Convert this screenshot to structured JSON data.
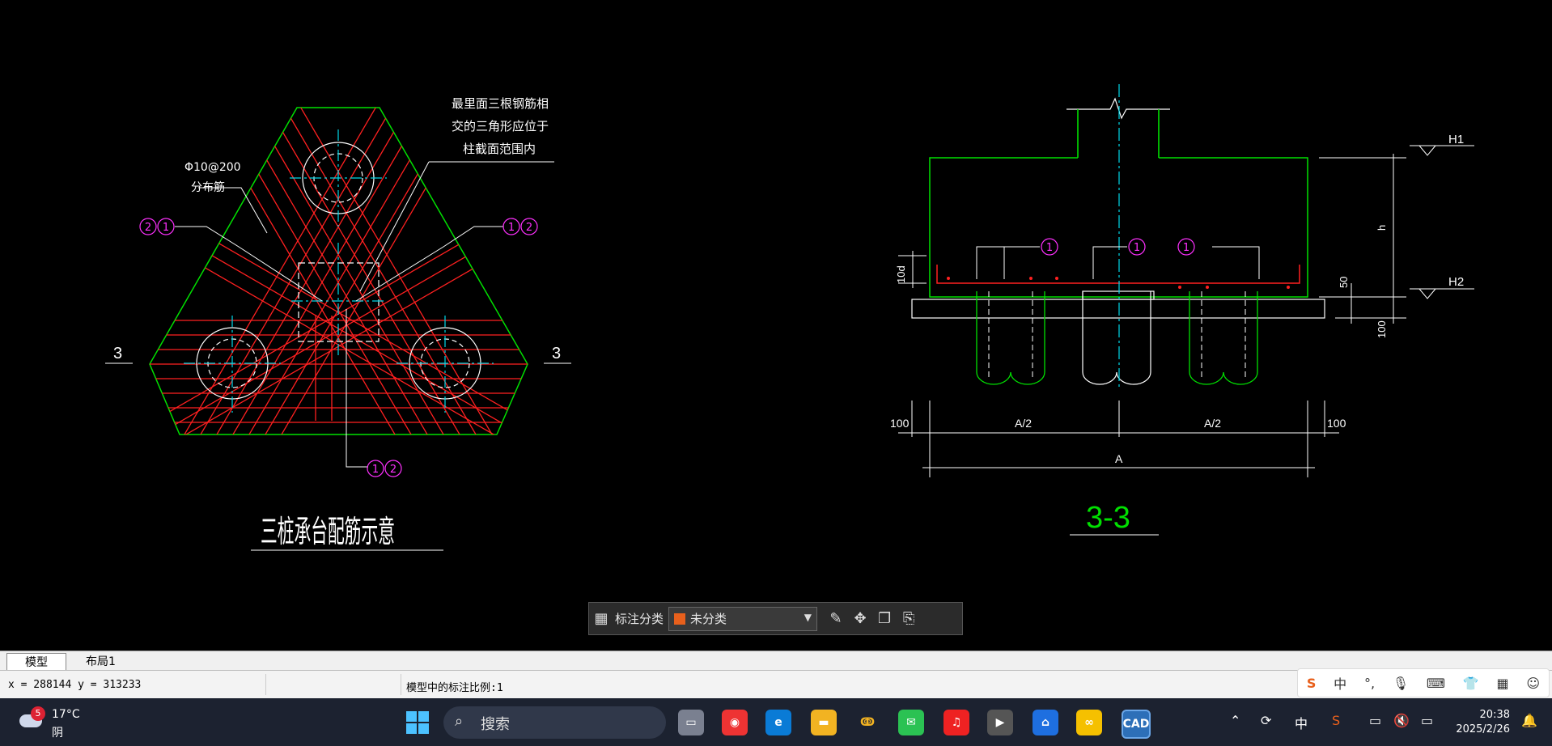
{
  "drawing": {
    "left_title": "三桩承台配筋示意",
    "right_title": "3-3",
    "note_top": [
      "最里面三根钢筋相",
      "交的三角形应位于",
      "柱截面范围内"
    ],
    "note_left": [
      "Φ10@200",
      "分布筋"
    ],
    "section_mark_left": "3",
    "section_mark_right": "3",
    "bubble_1": "1",
    "bubble_2": "2",
    "dim_100_left": "100",
    "dim_100_right": "100",
    "dim_a2_left": "A/2",
    "dim_a2_right": "A/2",
    "dim_a": "A",
    "dim_h": "h",
    "dim_10d": "10d",
    "dim_50": "50",
    "dim_100_v": "100",
    "level_h1": "H1",
    "level_h2": "H2"
  },
  "float_toolbar": {
    "label": "标注分类",
    "selected": "未分类",
    "swatch_color": "#e8601c"
  },
  "tabs": [
    "模型",
    "布局1"
  ],
  "status": {
    "coords": "x = 288144  y = 313233",
    "scale": "模型中的标注比例:1"
  },
  "ime": {
    "lang": "中",
    "punct": "°,"
  },
  "taskbar": {
    "weather_badge": "5",
    "temp": "17°C",
    "cond": "阴",
    "search_placeholder": "搜索",
    "tray_lang": "中",
    "time": "20:38",
    "date": "2025/2/26"
  },
  "colors": {
    "green": "#00e000",
    "red": "#ff2020",
    "cyan": "#00d8e8",
    "magenta": "#ff30ff",
    "white": "#ffffff"
  }
}
